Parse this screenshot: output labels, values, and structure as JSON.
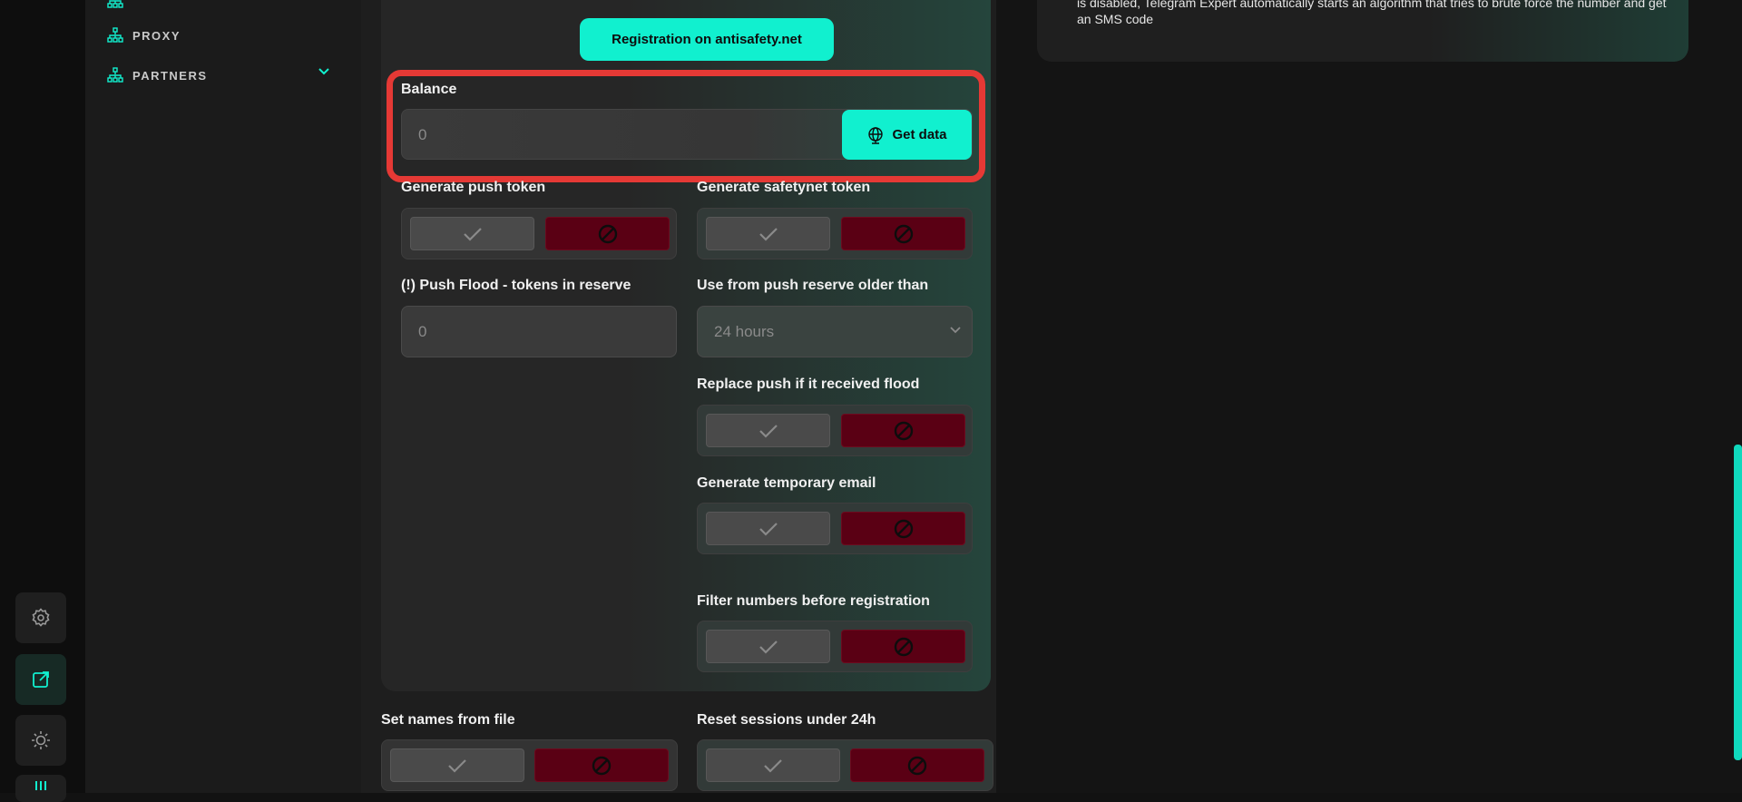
{
  "sidebar": {
    "items": [
      {
        "label": "PROXY",
        "icon": "network-icon"
      },
      {
        "label": "PARTNERS",
        "icon": "network-icon"
      }
    ]
  },
  "rail": {
    "icons": [
      "gear-icon",
      "external-link-icon",
      "sun-icon",
      "bars-icon"
    ]
  },
  "info": {
    "text": "is disabled, Telegram Expert automatically starts an algorithm that tries to brute force the number and get an SMS code"
  },
  "form": {
    "registration_button": "Registration on antisafety.net",
    "balance_label": "Balance",
    "balance_placeholder": "0",
    "get_data_button": "Get data",
    "push_token_label": "Generate push token",
    "safetynet_label": "Generate safetynet token",
    "push_flood_label": "(!) Push Flood - tokens in reserve",
    "push_flood_placeholder": "0",
    "push_reserve_label": "Use from push reserve older than",
    "push_reserve_value": "24 hours",
    "replace_push_label": "Replace push if it received flood",
    "temp_email_label": "Generate temporary email",
    "filter_numbers_label": "Filter numbers before registration",
    "set_names_label": "Set names from file",
    "reset_sessions_label": "Reset sessions under 24h"
  },
  "colors": {
    "accent": "#11f0cf",
    "danger": "#5a0014",
    "highlight": "#e53935"
  }
}
